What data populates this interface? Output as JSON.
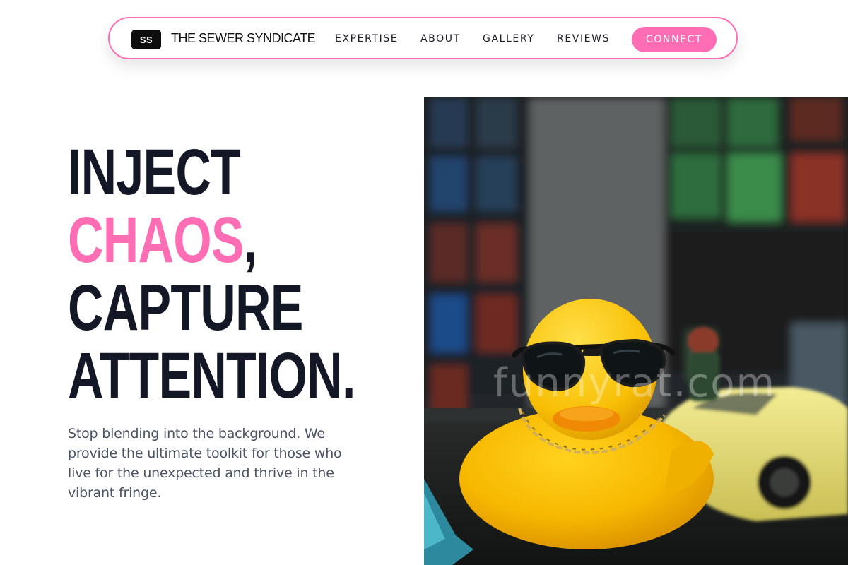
{
  "brand": {
    "badge": "SS",
    "name": "THE SEWER SYNDICATE"
  },
  "nav": {
    "links": [
      "EXPERTISE",
      "ABOUT",
      "GALLERY",
      "REVIEWS"
    ],
    "cta": "CONNECT"
  },
  "hero": {
    "headline": {
      "line1": "INJECT",
      "line2_accent": "CHAOS",
      "line2_rest": ",",
      "line3": "CAPTURE",
      "line4": "ATTENTION."
    },
    "body": "Stop blending into the background. We provide the ultimate toolkit for those who live for the unexpected and thrive in the vibrant fringe.",
    "image_watermark": "funnyrat.com"
  },
  "colors": {
    "accent": "#ff6eb4",
    "headline": "#141826",
    "body_text": "#4a5263"
  },
  "icons": {
    "hero_image": "rubber-duck-with-sunglasses-photo"
  }
}
